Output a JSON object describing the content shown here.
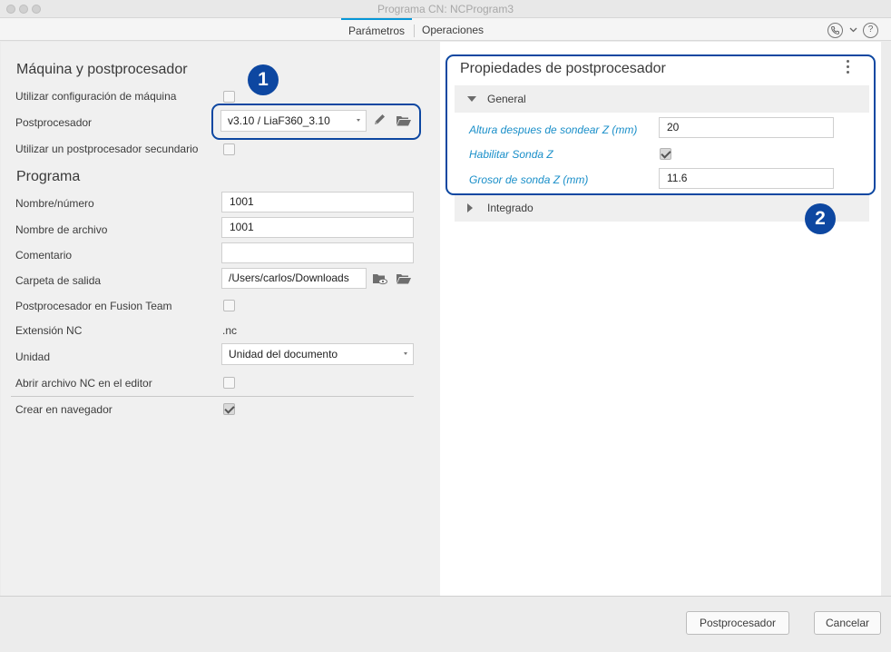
{
  "window": {
    "title": "Programa CN: NCProgram3"
  },
  "tabs": [
    {
      "label": "Parámetros",
      "active": true
    },
    {
      "label": "Operaciones",
      "active": false
    }
  ],
  "header_icons": [
    "phone-icon",
    "chevron-down-icon",
    "help-icon"
  ],
  "help_glyph": "?",
  "machine_section": {
    "title": "Máquina y postprocesador",
    "use_machine_config": {
      "label": "Utilizar configuración de máquina",
      "checked": false
    },
    "postprocessor": {
      "label": "Postprocesador",
      "value": "v3.10 / LiaF360_3.10"
    },
    "use_secondary": {
      "label": "Utilizar un postprocesador secundario",
      "checked": false
    }
  },
  "program_section": {
    "title": "Programa",
    "name_number": {
      "label": "Nombre/número",
      "value": "1001"
    },
    "file_name": {
      "label": "Nombre de archivo",
      "value": "1001"
    },
    "comment": {
      "label": "Comentario",
      "value": ""
    },
    "output_folder": {
      "label": "Carpeta de salida",
      "value": "/Users/carlos/Downloads"
    },
    "fusion_team": {
      "label": "Postprocesador en Fusion Team",
      "checked": false
    },
    "nc_extension": {
      "label": "Extensión NC",
      "value": ".nc"
    },
    "unit": {
      "label": "Unidad",
      "value": "Unidad del documento"
    },
    "open_in_editor": {
      "label": "Abrir archivo NC en el editor",
      "checked": false
    },
    "create_in_browser": {
      "label": "Crear en navegador",
      "checked": true
    }
  },
  "post_props": {
    "title": "Propiedades de postprocesador",
    "groups": [
      {
        "label": "General",
        "expanded": true,
        "properties": [
          {
            "label": "Altura despues de sondear Z (mm)",
            "value": "20"
          },
          {
            "label": "Habilitar Sonda Z",
            "checked": true
          },
          {
            "label": "Grosor de sonda Z (mm)",
            "value": "11.6"
          }
        ]
      },
      {
        "label": "Integrado",
        "expanded": false
      }
    ]
  },
  "callouts": [
    "1",
    "2"
  ],
  "buttons": {
    "postprocess": "Postprocesador",
    "cancel": "Cancelar"
  },
  "colors": {
    "accent_tab": "#0696d7",
    "property_label": "#1a8fc9",
    "callout": "#0d47a1"
  }
}
